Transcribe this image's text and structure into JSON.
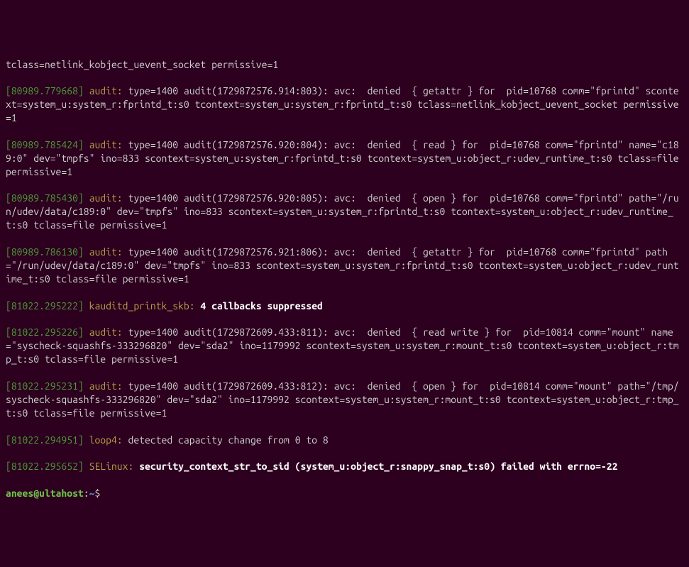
{
  "lines": {
    "l0": "tclass=netlink_kobject_uevent_socket permissive=1",
    "ts1": "[80989.779668]",
    "tag1": "audit:",
    "l1": " type=1400 audit(1729872576.914:803): avc:  denied  { getattr } for  pid=10768 comm=\"fprintd\" scontext=system_u:system_r:fprintd_t:s0 tcontext=system_u:system_r:fprintd_t:s0 tclass=netlink_kobject_uevent_socket permissive=1",
    "ts2": "[80989.785424]",
    "tag2": "audit:",
    "l2": " type=1400 audit(1729872576.920:804): avc:  denied  { read } for  pid=10768 comm=\"fprintd\" name=\"c189:0\" dev=\"tmpfs\" ino=833 scontext=system_u:system_r:fprintd_t:s0 tcontext=system_u:object_r:udev_runtime_t:s0 tclass=file permissive=1",
    "ts3": "[80989.785430]",
    "tag3": "audit:",
    "l3": " type=1400 audit(1729872576.920:805): avc:  denied  { open } for  pid=10768 comm=\"fprintd\" path=\"/run/udev/data/c189:0\" dev=\"tmpfs\" ino=833 scontext=system_u:system_r:fprintd_t:s0 tcontext=system_u:object_r:udev_runtime_t:s0 tclass=file permissive=1",
    "ts4": "[80989.786130]",
    "tag4": "audit:",
    "l4": " type=1400 audit(1729872576.921:806): avc:  denied  { getattr } for  pid=10768 comm=\"fprintd\" path=\"/run/udev/data/c189:0\" dev=\"tmpfs\" ino=833 scontext=system_u:system_r:fprintd_t:s0 tcontext=system_u:object_r:udev_runtime_t:s0 tclass=file permissive=1",
    "ts5": "[81022.295222]",
    "tag5": "kauditd_printk_skb:",
    "l5b": "4 callbacks suppressed",
    "ts6": "[81022.295226]",
    "tag6": "audit:",
    "l6": " type=1400 audit(1729872609.433:811): avc:  denied  { read write } for  pid=10814 comm=\"mount\" name=\"syscheck-squashfs-333296820\" dev=\"sda2\" ino=1179992 scontext=system_u:system_r:mount_t:s0 tcontext=system_u:object_r:tmp_t:s0 tclass=file permissive=1",
    "ts7": "[81022.295231]",
    "tag7": "audit:",
    "l7": " type=1400 audit(1729872609.433:812): avc:  denied  { open } for  pid=10814 comm=\"mount\" path=\"/tmp/syscheck-squashfs-333296820\" dev=\"sda2\" ino=1179992 scontext=system_u:system_r:mount_t:s0 tcontext=system_u:object_r:tmp_t:s0 tclass=file permissive=1",
    "ts8": "[81022.294951]",
    "tag8": "loop4:",
    "l8": " detected capacity change from 0 to 8",
    "ts9": "[81022.295652]",
    "tag9": "SELinux:",
    "l9b": "security_context_str_to_sid (system_u:object_r:snappy_snap_t:s0) failed with errno=-22"
  },
  "prompt": {
    "user": "anees",
    "at": "@",
    "host": "ultahost",
    "colon": ":",
    "path": "~",
    "dollar": "$ "
  }
}
